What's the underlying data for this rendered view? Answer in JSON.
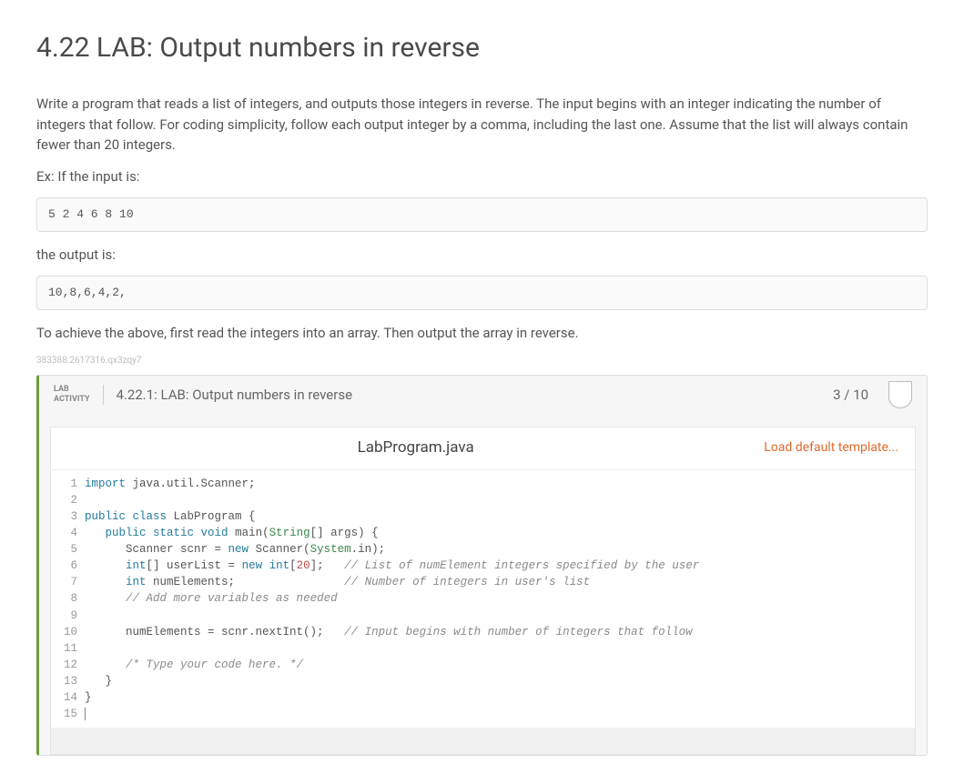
{
  "title": "4.22 LAB: Output numbers in reverse",
  "desc": "Write a program that reads a list of integers, and outputs those integers in reverse. The input begins with an integer indicating the number of integers that follow. For coding simplicity, follow each output integer by a comma, including the last one. Assume that the list will always contain fewer than 20 integers.",
  "ex_label": "Ex: If the input is:",
  "input_example": "5 2 4 6 8 10",
  "output_label": "the output is:",
  "output_example": "10,8,6,4,2,",
  "hint": "To achieve the above, first read the integers into an array. Then output the array in reverse.",
  "small_id": "383388.2617316.qx3zqy7",
  "lab": {
    "tag_line1": "LAB",
    "tag_line2": "ACTIVITY",
    "subtitle": "4.22.1: LAB: Output numbers in reverse",
    "score": "3 / 10",
    "filename": "LabProgram.java",
    "load_template": "Load default template...",
    "gutter": " 1\n 2\n 3\n 4\n 5\n 6\n 7\n 8\n 9\n10\n11\n12\n13\n14\n15",
    "code": {
      "l1_a": "import",
      "l1_b": " java.util.Scanner;",
      "l3_a": "public",
      "l3_b": " class",
      "l3_c": " LabProgram {",
      "l4_a": "   public",
      "l4_b": " static",
      "l4_c": " void",
      "l4_d": " main(",
      "l4_e": "String",
      "l4_f": "[] args) {",
      "l5_a": "      Scanner scnr = ",
      "l5_b": "new",
      "l5_c": " Scanner(",
      "l5_d": "System",
      "l5_e": ".in);",
      "l6_a": "      int",
      "l6_b": "[] userList = ",
      "l6_c": "new",
      "l6_d": " int",
      "l6_e": "[",
      "l6_f": "20",
      "l6_g": "];   ",
      "l6_h": "// List of numElement integers specified by the user",
      "l7_a": "      int",
      "l7_b": " numElements;                ",
      "l7_c": "// Number of integers in user's list",
      "l8_a": "      ",
      "l8_b": "// Add more variables as needed",
      "l10_a": "      numElements = scnr.nextInt();   ",
      "l10_b": "// Input begins with number of integers that follow",
      "l12_a": "      ",
      "l12_b": "/* Type your code here. */",
      "l13": "   }",
      "l14": "}"
    }
  }
}
